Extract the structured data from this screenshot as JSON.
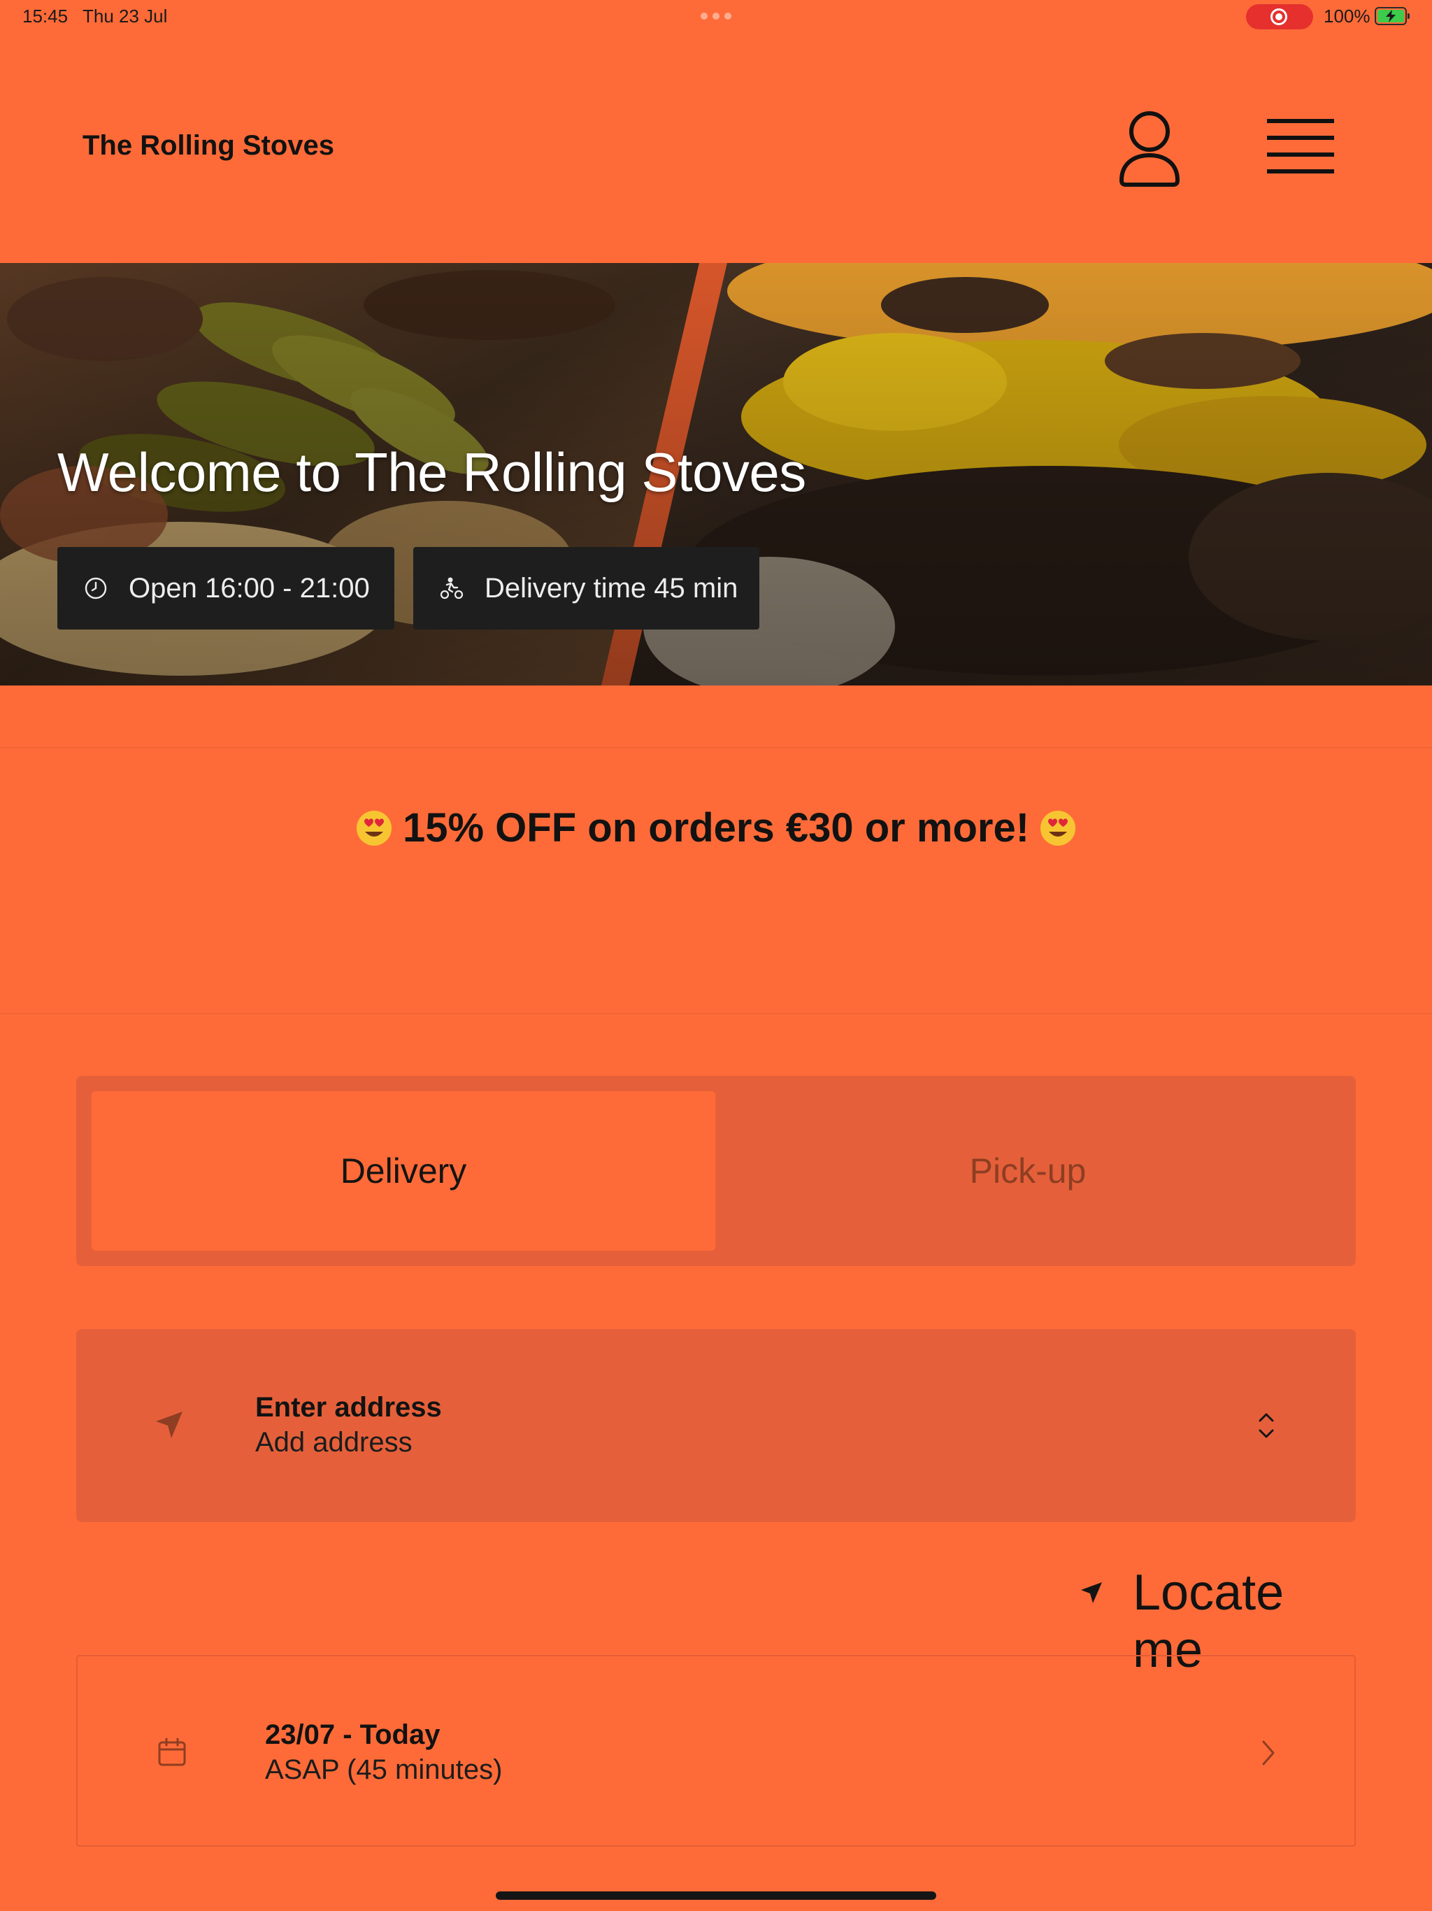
{
  "status_bar": {
    "time": "15:45",
    "date": "Thu 23 Jul",
    "battery": "100%"
  },
  "header": {
    "title": "The Rolling Stoves",
    "icons": [
      "user-icon",
      "hamburger-menu-icon"
    ]
  },
  "hero": {
    "title": "Welcome to The Rolling Stoves",
    "open_hours": "Open 16:00 - 21:00",
    "delivery_time": "Delivery time 45 min"
  },
  "promo": {
    "text": "15% OFF on orders €30 or more!",
    "emoji": "heart-eyes-emoji"
  },
  "order_type": {
    "options": [
      "Delivery",
      "Pick-up"
    ],
    "selected": "Delivery"
  },
  "address": {
    "title": "Enter address",
    "subtitle": "Add address"
  },
  "locate": {
    "label": "Locate me"
  },
  "schedule": {
    "title": "23/07 - Today",
    "subtitle": "ASAP (45 minutes)"
  },
  "colors": {
    "background": "#FF6B38",
    "panel": "#E5603A",
    "chip": "#1E1E1E",
    "inactive_text": "#8E3E22"
  }
}
